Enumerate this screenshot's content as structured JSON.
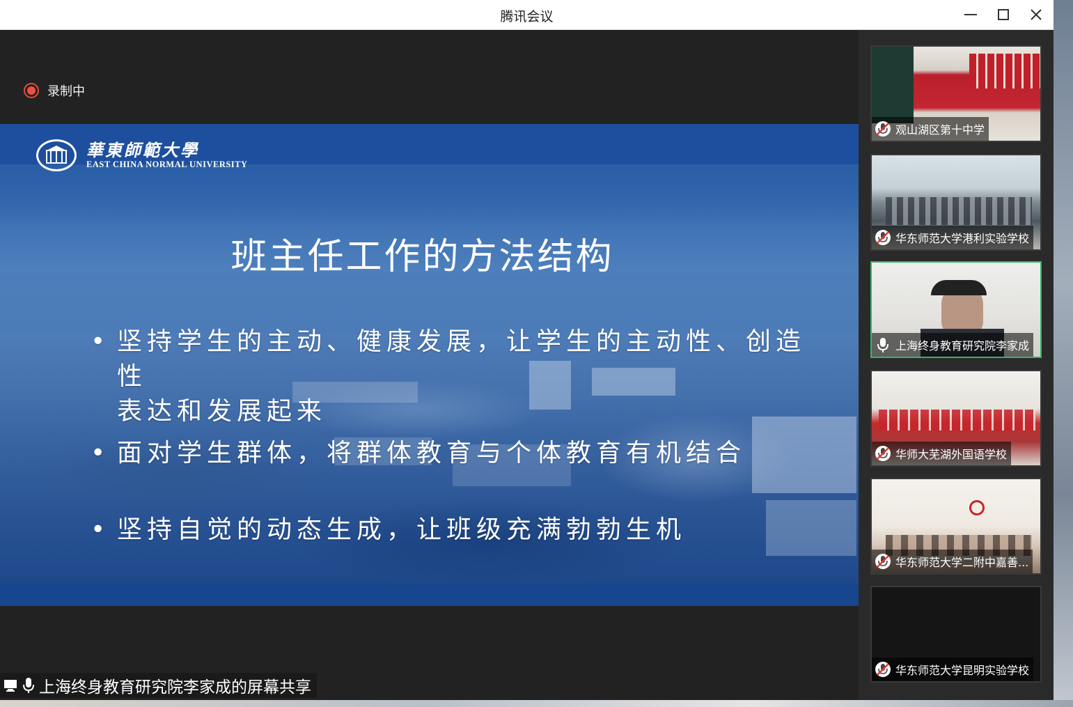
{
  "window": {
    "title": "腾讯会议"
  },
  "recording": {
    "label": "录制中"
  },
  "slide": {
    "university_cn": "華東師範大學",
    "university_en": "EAST CHINA NORMAL UNIVERSITY",
    "title": "班主任工作的方法结构",
    "bullets": [
      {
        "line1": "坚持学生的主动、健康发展，让学生的主动性、创造性",
        "line2": "表达和发展起来"
      },
      {
        "line1": "面对学生群体，将群体教育与个体教育有机结合"
      },
      {
        "line1": "坚持自觉的动态生成，让班级充满勃勃生机"
      }
    ]
  },
  "screen_share": {
    "label": "上海终身教育研究院李家成的屏幕共享"
  },
  "participants": [
    {
      "name": "观山湖区第十中学",
      "mic": "muted"
    },
    {
      "name": "华东师范大学港利实验学校",
      "mic": "muted"
    },
    {
      "name": "上海终身教育研究院李家成",
      "mic": "on",
      "speaking": true
    },
    {
      "name": "华师大芜湖外国语学校",
      "mic": "muted"
    },
    {
      "name": "华东师范大学二附中嘉善...",
      "mic": "muted"
    },
    {
      "name": "华东师范大学昆明实验学校",
      "mic": "muted"
    }
  ]
}
